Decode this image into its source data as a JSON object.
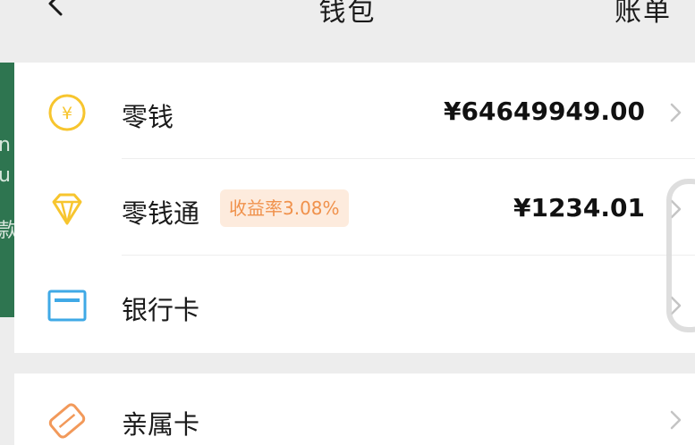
{
  "header": {
    "title": "钱包",
    "bill_label": "账单"
  },
  "background_peek": [
    "n",
    "u",
    "款"
  ],
  "wallet_items": [
    {
      "label": "零钱",
      "amount": "¥64649949.00",
      "icon": "yuan-coin-icon"
    },
    {
      "label": "零钱通",
      "badge": "收益率3.08%",
      "amount": "¥1234.01",
      "icon": "diamond-icon"
    },
    {
      "label": "银行卡",
      "icon": "bank-card-icon"
    }
  ],
  "extra_items": [
    {
      "label": "亲属卡",
      "icon": "family-card-icon"
    }
  ],
  "colors": {
    "background": "#ededed",
    "card": "#ffffff",
    "badge_bg": "#fdebdd",
    "badge_text": "#f0914b",
    "coin_yellow": "#f7c52e",
    "bank_blue": "#3fa9e6",
    "family_orange": "#f2995a",
    "peek_green": "#2e7550"
  }
}
